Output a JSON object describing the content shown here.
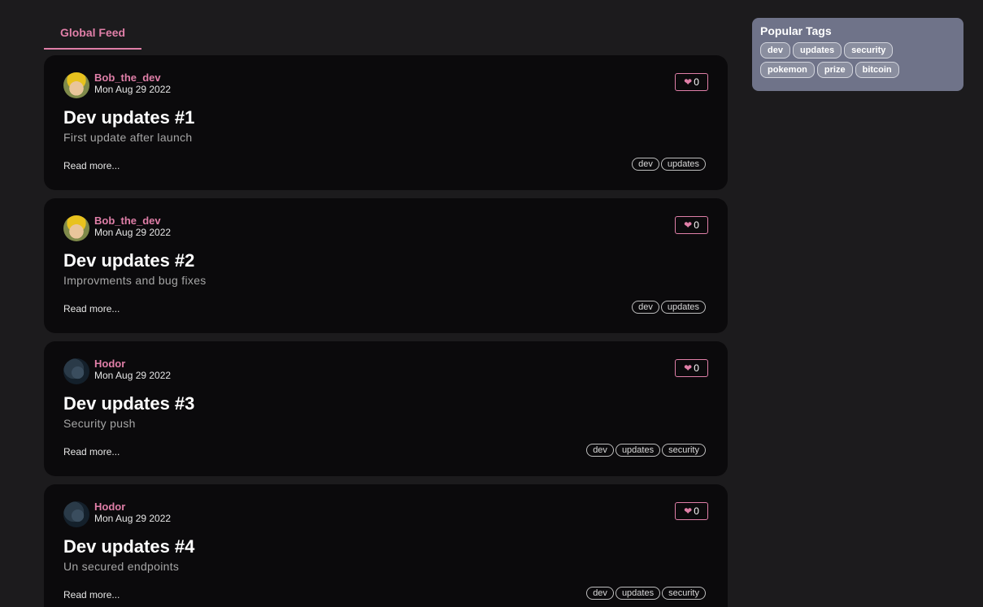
{
  "feed": {
    "tab_label": "Global Feed"
  },
  "articles": [
    {
      "author": "Bob_the_dev",
      "avatar": "bob",
      "date": "Mon Aug 29 2022",
      "likes": "0",
      "title": "Dev updates #1",
      "description": "First update after launch",
      "read_more": "Read more...",
      "tags": [
        "dev",
        "updates"
      ]
    },
    {
      "author": "Bob_the_dev",
      "avatar": "bob",
      "date": "Mon Aug 29 2022",
      "likes": "0",
      "title": "Dev updates #2",
      "description": "Improvments and bug fixes",
      "read_more": "Read more...",
      "tags": [
        "dev",
        "updates"
      ]
    },
    {
      "author": "Hodor",
      "avatar": "hodor",
      "date": "Mon Aug 29 2022",
      "likes": "0",
      "title": "Dev updates #3",
      "description": "Security push",
      "read_more": "Read more...",
      "tags": [
        "dev",
        "updates",
        "security"
      ]
    },
    {
      "author": "Hodor",
      "avatar": "hodor",
      "date": "Mon Aug 29 2022",
      "likes": "0",
      "title": "Dev updates #4",
      "description": "Un secured endpoints",
      "read_more": "Read more...",
      "tags": [
        "dev",
        "updates",
        "security"
      ]
    }
  ],
  "sidebar": {
    "title": "Popular Tags",
    "tags": [
      "dev",
      "updates",
      "security",
      "pokemon",
      "prize",
      "bitcoin"
    ]
  },
  "icons": {
    "like": "heart-icon"
  },
  "colors": {
    "accent": "#e07fa8",
    "background": "#1c1b1d",
    "card": "#0b0a0c",
    "sidebar": "#6f7389"
  }
}
